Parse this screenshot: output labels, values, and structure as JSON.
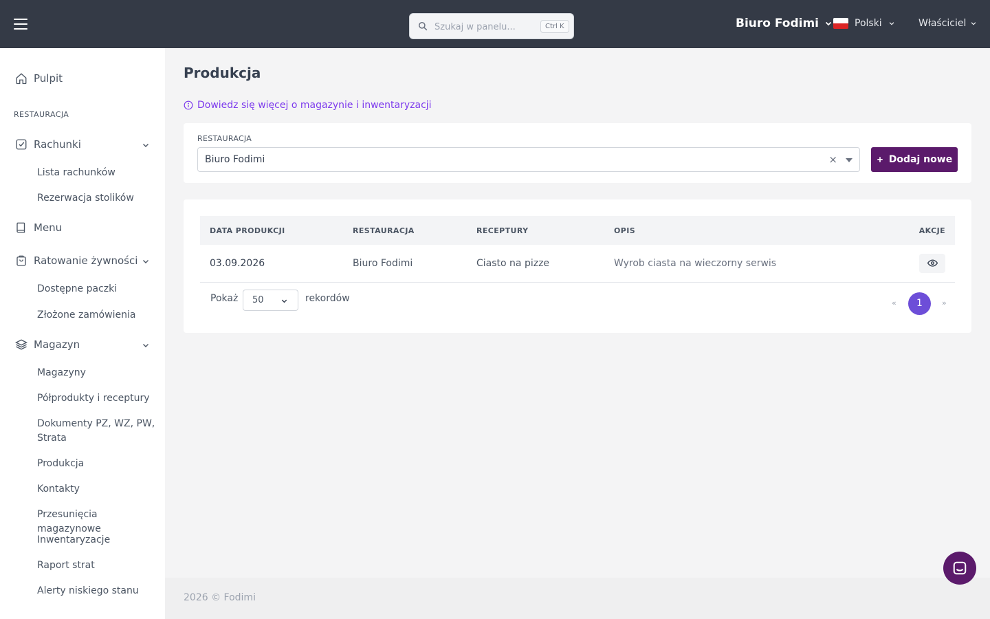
{
  "header": {
    "search_placeholder": "Szukaj w panelu...",
    "search_shortcut": "Ctrl K",
    "brand": "Biuro Fodimi",
    "language": "Polski",
    "user_role": "Właściciel"
  },
  "sidebar": {
    "dashboard": "Pulpit",
    "section_restaurant": "RESTAURACJA",
    "bills": "Rachunki",
    "bills_list": "Lista rachunków",
    "table_reservation": "Rezerwacja stolików",
    "menu": "Menu",
    "food_rescue": "Ratowanie żywności",
    "available_packages": "Dostępne paczki",
    "placed_orders": "Złożone zamówienia",
    "warehouse": "Magazyn",
    "warehouses": "Magazyny",
    "semi_products": "Półprodukty i receptury",
    "documents": "Dokumenty PZ, WZ, PW, Strata",
    "production": "Produkcja",
    "contacts": "Kontakty",
    "transfers": "Przesunięcia magazynowe",
    "inventories": "Inwentaryzacje",
    "loss_report": "Raport strat",
    "low_stock_alerts": "Alerty niskiego stanu"
  },
  "main": {
    "title": "Produkcja",
    "info_link": "Dowiedz się więcej o magazynie i inwentaryzacji",
    "filter": {
      "label": "RESTAURACJA",
      "value": "Biuro Fodimi",
      "clear": "×"
    },
    "add_button": "Dodaj nowe",
    "table": {
      "columns": [
        "DATA PRODUKCJI",
        "RESTAURACJA",
        "RECEPTURY",
        "OPIS",
        "AKCJE"
      ],
      "rows": [
        {
          "date": "03.09.2026",
          "restaurant": "Biuro Fodimi",
          "recipe": "Ciasto na pizze",
          "description": "Wyrob ciasta na wieczorny serwis"
        }
      ]
    },
    "pagination": {
      "show_label": "Pokaż",
      "per_page": "50",
      "records_label": "rekordów",
      "prev": "«",
      "current": "1",
      "next": "»"
    }
  },
  "footer": {
    "text": "2026 © Fodimi"
  },
  "colors": {
    "header_bg": "#343a46",
    "accent": "#5b1a6b",
    "page_active": "#6d4ed8",
    "link": "#7c3aed"
  }
}
